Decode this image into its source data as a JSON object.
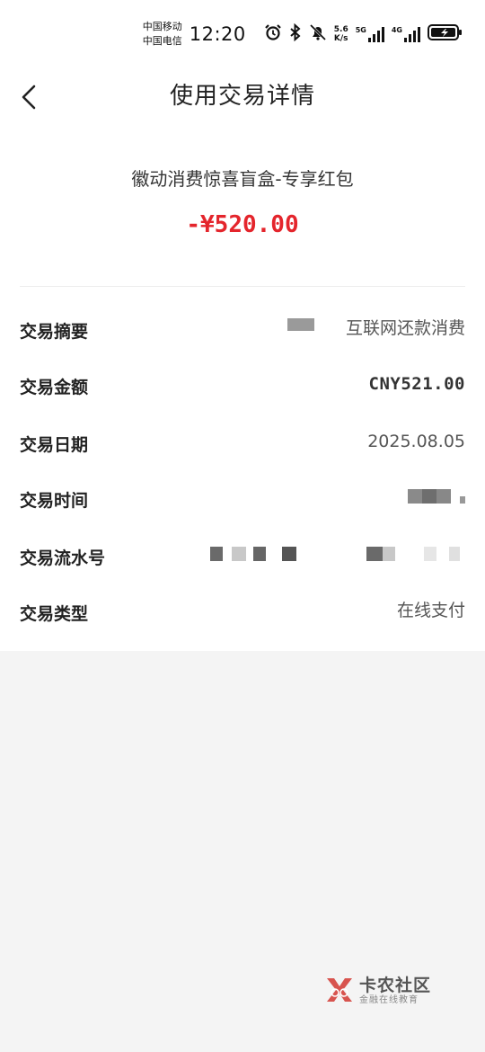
{
  "status_bar": {
    "carrier_1": "中国移动",
    "carrier_2": "中国电信",
    "time": "12:20",
    "speed_value": "5.6",
    "speed_unit": "K/s",
    "network_1": "5G",
    "network_2": "4G",
    "icons": [
      "alarm-icon",
      "bluetooth-icon",
      "mute-icon",
      "signal-icon",
      "battery-charging-icon"
    ]
  },
  "nav": {
    "title": "使用交易详情",
    "back_icon": "chevron-left-icon"
  },
  "summary": {
    "product_name": "徽动消费惊喜盲盒-专享红包",
    "amount": "-¥520.00"
  },
  "details": [
    {
      "label": "交易摘要",
      "value": "互联网还款消费"
    },
    {
      "label": "交易金额",
      "value": "CNY521.00"
    },
    {
      "label": "交易日期",
      "value": "2025.08.05"
    },
    {
      "label": "交易时间",
      "value": ""
    },
    {
      "label": "交易流水号",
      "value": ""
    },
    {
      "label": "交易类型",
      "value": "在线支付"
    }
  ],
  "watermark": {
    "title": "卡农社区",
    "subtitle": "金融在线教育"
  },
  "colors": {
    "accent_red": "#e4252c",
    "background": "#f4f4f4",
    "card": "#ffffff"
  }
}
